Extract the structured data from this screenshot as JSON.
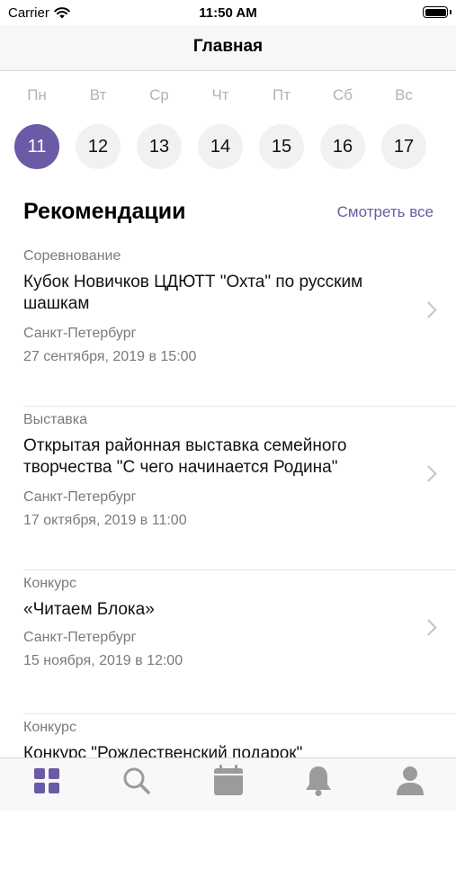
{
  "status_bar": {
    "carrier": "Carrier",
    "time": "11:50 AM"
  },
  "nav": {
    "title": "Главная"
  },
  "week": [
    {
      "name": "Пн",
      "num": "11",
      "active": true
    },
    {
      "name": "Вт",
      "num": "12",
      "active": false
    },
    {
      "name": "Ср",
      "num": "13",
      "active": false
    },
    {
      "name": "Чт",
      "num": "14",
      "active": false
    },
    {
      "name": "Пт",
      "num": "15",
      "active": false
    },
    {
      "name": "Сб",
      "num": "16",
      "active": false
    },
    {
      "name": "Вс",
      "num": "17",
      "active": false
    }
  ],
  "recommendations": {
    "title": "Рекомендации",
    "see_all": "Смотреть все",
    "events": [
      {
        "type": "Соревнование",
        "title": "Кубок Новичков ЦДЮТТ \"Охта\" по русским шашкам",
        "city": "Санкт-Петербург",
        "date": "27 сентября, 2019 в 15:00"
      },
      {
        "type": "Выставка",
        "title": "Открытая районная выставка семейного творчества \"С чего начинается Родина\"",
        "city": "Санкт-Петербург",
        "date": "17 октября, 2019 в 11:00"
      },
      {
        "type": "Конкурс",
        "title": "«Читаем Блока»",
        "city": "Санкт-Петербург",
        "date": "15 ноября, 2019 в 12:00"
      },
      {
        "type": "Конкурс",
        "title": "Конкурс \"Рождественский подарок\"",
        "city": "",
        "date": ""
      }
    ]
  },
  "tabbar": {
    "tabs": [
      {
        "icon": "grid-icon",
        "active": true
      },
      {
        "icon": "search-icon",
        "active": false
      },
      {
        "icon": "calendar-icon",
        "active": false
      },
      {
        "icon": "bell-icon",
        "active": false
      },
      {
        "icon": "profile-icon",
        "active": false
      }
    ]
  },
  "colors": {
    "accent": "#6b5aa6",
    "inactive_icon": "#9b9b9b"
  }
}
